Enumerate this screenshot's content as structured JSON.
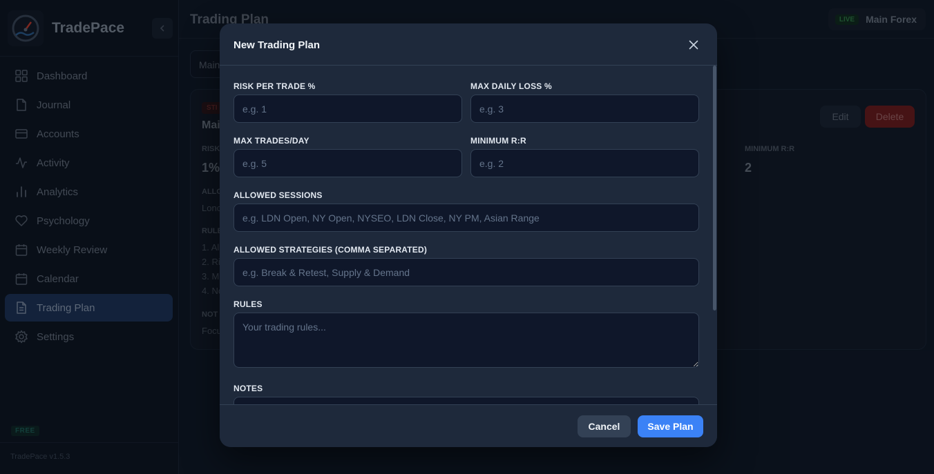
{
  "app": {
    "name": "TradePace",
    "version": "TradePace v1.5.3",
    "plan_badge": "FREE"
  },
  "sidebar": {
    "items": [
      {
        "label": "Dashboard",
        "icon": "grid-icon"
      },
      {
        "label": "Journal",
        "icon": "file-icon"
      },
      {
        "label": "Accounts",
        "icon": "card-icon"
      },
      {
        "label": "Activity",
        "icon": "activity-icon"
      },
      {
        "label": "Analytics",
        "icon": "bar-chart-icon"
      },
      {
        "label": "Psychology",
        "icon": "heart-icon"
      },
      {
        "label": "Weekly Review",
        "icon": "calendar-icon"
      },
      {
        "label": "Calendar",
        "icon": "calendar-icon"
      },
      {
        "label": "Trading Plan",
        "icon": "document-icon",
        "active": true
      },
      {
        "label": "Settings",
        "icon": "gear-icon"
      }
    ]
  },
  "header": {
    "title": "Trading Plan",
    "account_status": "LIVE",
    "account_name": "Main Forex"
  },
  "background": {
    "account_select": "Main",
    "status_tag": "STI",
    "card_title": "Mai",
    "edit_label": "Edit",
    "delete_label": "Delete",
    "risk_label": "RISK",
    "risk_value": "1%",
    "min_rr_label": "MINIMUM R:R",
    "min_rr_value": "2",
    "allowed_label": "ALLO",
    "allowed_value": "Lonc",
    "rules_label": "RULE",
    "rules": [
      "1. Al",
      "2. Ris",
      "3. M",
      "4. No"
    ],
    "notes_label": "NOT",
    "notes_value": "Focu"
  },
  "modal": {
    "title": "New Trading Plan",
    "fields": {
      "risk_per_trade": {
        "label": "RISK PER TRADE %",
        "placeholder": "e.g. 1"
      },
      "max_daily_loss": {
        "label": "MAX DAILY LOSS %",
        "placeholder": "e.g. 3"
      },
      "max_trades": {
        "label": "MAX TRADES/DAY",
        "placeholder": "e.g. 5"
      },
      "min_rr": {
        "label": "MINIMUM R:R",
        "placeholder": "e.g. 2"
      },
      "sessions": {
        "label": "ALLOWED SESSIONS",
        "placeholder": "e.g. LDN Open, NY Open, NYSEO, LDN Close, NY PM, Asian Range"
      },
      "strategies": {
        "label": "ALLOWED STRATEGIES (COMMA SEPARATED)",
        "placeholder": "e.g. Break & Retest, Supply & Demand"
      },
      "rules": {
        "label": "RULES",
        "placeholder": "Your trading rules..."
      },
      "notes": {
        "label": "NOTES"
      }
    },
    "cancel_label": "Cancel",
    "save_label": "Save Plan"
  }
}
